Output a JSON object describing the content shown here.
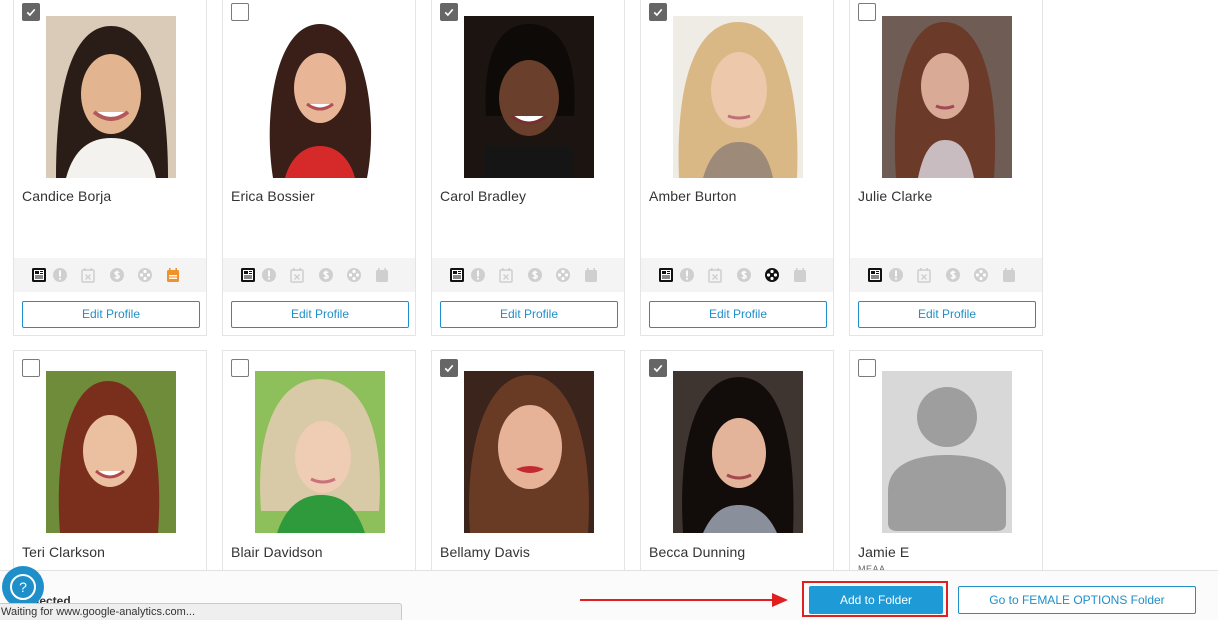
{
  "cards": [
    {
      "name": "Candice Borja",
      "checked": true
    },
    {
      "name": "Erica Bossier",
      "checked": false
    },
    {
      "name": "Carol Bradley",
      "checked": true
    },
    {
      "name": "Amber Burton",
      "checked": true
    },
    {
      "name": "Julie Clarke",
      "checked": false
    },
    {
      "name": "Teri Clarkson",
      "checked": false
    },
    {
      "name": "Blair Davidson",
      "checked": false
    },
    {
      "name": "Bellamy Davis",
      "checked": true
    },
    {
      "name": "Becca Dunning",
      "checked": true
    },
    {
      "name": "Jamie E",
      "subname": "MEAA",
      "checked": false
    }
  ],
  "card_actions": {
    "edit_profile_label": "Edit Profile"
  },
  "icon_names": [
    "resume-icon",
    "alert-icon",
    "calendar-x-icon",
    "dollar-icon",
    "film-reel-icon",
    "calendar-icon"
  ],
  "icon_states": [
    {
      "calendar_active": true,
      "film_active": false
    },
    {
      "calendar_active": false,
      "film_active": false
    },
    {
      "calendar_active": false,
      "film_active": false
    },
    {
      "calendar_active": false,
      "film_active": true
    },
    {
      "calendar_active": false,
      "film_active": false
    }
  ],
  "footer": {
    "selected_text": "lected",
    "add_to_folder_label": "Add to Folder",
    "goto_folder_label": "Go to FEMALE OPTIONS Folder",
    "help_label": "?"
  },
  "browser_status": "Waiting for www.google-analytics.com...",
  "colors": {
    "accent": "#1e8fc9",
    "button_fill": "#1e9bd7",
    "highlight": "#e02020",
    "calendar_active": "#f0922b"
  }
}
